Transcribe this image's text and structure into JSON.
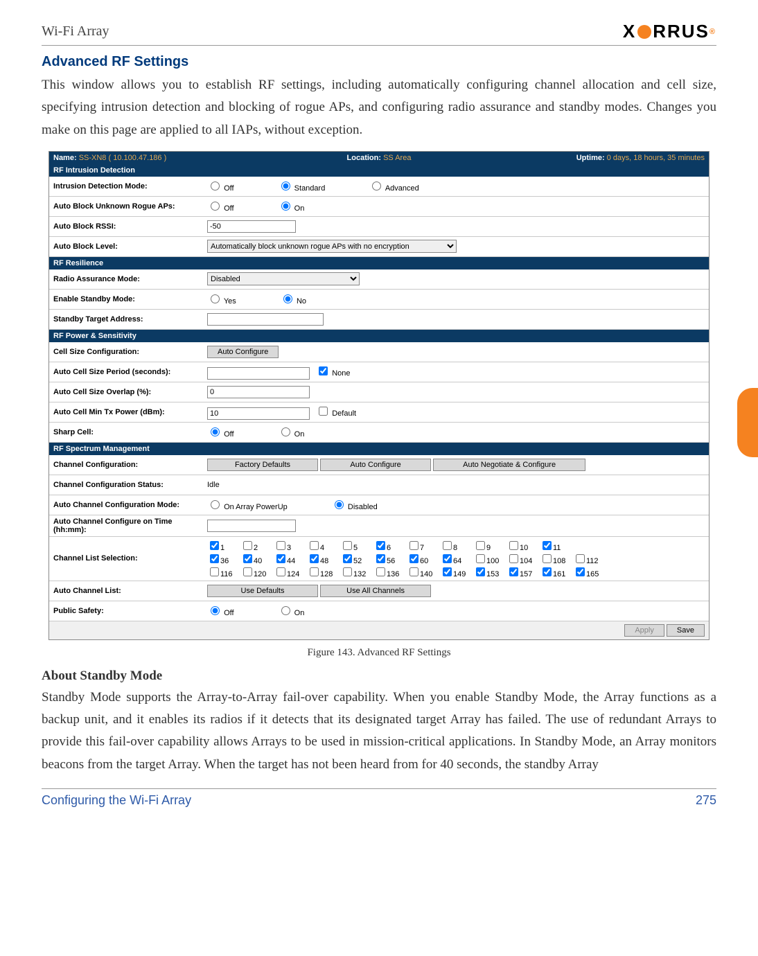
{
  "header": {
    "left": "Wi-Fi Array",
    "logo_text": "XIRRUS"
  },
  "section_title": "Advanced RF Settings",
  "intro": "This window allows you to establish RF settings, including automatically configuring channel allocation and cell size, specifying intrusion detection and blocking of rogue APs, and configuring radio assurance and standby modes. Changes you make on this page are applied to all IAPs, without exception.",
  "fig_caption": "Figure 143. Advanced RF Settings",
  "subhead": "About Standby Mode",
  "standby_text": "Standby Mode supports the Array-to-Array fail-over capability. When you enable Standby Mode, the Array functions as a backup unit, and it enables its radios if it detects that its designated target Array has failed. The use of redundant Arrays to provide this fail-over capability allows Arrays to be used in mission-critical applications. In Standby Mode, an Array monitors beacons from the target Array. When the target has not been heard from for 40 seconds, the standby Array",
  "footer": {
    "left": "Configuring the Wi-Fi Array",
    "page": "275"
  },
  "ui": {
    "top": {
      "name_lbl": "Name:",
      "name_val": "SS-XN8    ( 10.100.47.186 )",
      "loc_lbl": "Location:",
      "loc_val": "SS Area",
      "up_lbl": "Uptime:",
      "up_val": "0 days, 18 hours, 35 minutes"
    },
    "sect_intrusion": "RF Intrusion Detection",
    "idm_lbl": "Intrusion Detection Mode:",
    "idm_off": "Off",
    "idm_std": "Standard",
    "idm_adv": "Advanced",
    "abur_lbl": "Auto Block Unknown Rogue APs:",
    "abur_off": "Off",
    "abur_on": "On",
    "abrssi_lbl": "Auto Block RSSI:",
    "abrssi_val": "-50",
    "ablvl_lbl": "Auto Block Level:",
    "ablvl_val": "Automatically block unknown rogue APs with no encryption",
    "sect_res": "RF Resilience",
    "ram_lbl": "Radio Assurance Mode:",
    "ram_val": "Disabled",
    "esm_lbl": "Enable Standby Mode:",
    "esm_yes": "Yes",
    "esm_no": "No",
    "sta_lbl": "Standby Target Address:",
    "sta_val": "",
    "sect_pow": "RF Power & Sensitivity",
    "csc_lbl": "Cell Size Configuration:",
    "csc_btn": "Auto Configure",
    "acsp_lbl": "Auto Cell Size Period (seconds):",
    "acsp_val": "",
    "acsp_none": "None",
    "acso_lbl": "Auto Cell Size Overlap (%):",
    "acso_val": "0",
    "acmtp_lbl": "Auto Cell Min Tx Power (dBm):",
    "acmtp_val": "10",
    "acmtp_def": "Default",
    "sharp_lbl": "Sharp Cell:",
    "sharp_off": "Off",
    "sharp_on": "On",
    "sect_spec": "RF Spectrum Management",
    "cc_lbl": "Channel Configuration:",
    "cc_fd": "Factory Defaults",
    "cc_ac": "Auto Configure",
    "cc_anc": "Auto Negotiate & Configure",
    "ccs_lbl": "Channel Configuration Status:",
    "ccs_val": "Idle",
    "accm_lbl": "Auto Channel Configuration Mode:",
    "accm_pu": "On Array PowerUp",
    "accm_dis": "Disabled",
    "acct_lbl": "Auto Channel Configure on Time (hh:mm):",
    "acct_val": "",
    "cls_lbl": "Channel List Selection:",
    "acl_lbl": "Auto Channel List:",
    "acl_ud": "Use Defaults",
    "acl_uac": "Use All Channels",
    "ps_lbl": "Public Safety:",
    "ps_off": "Off",
    "ps_on": "On",
    "apply": "Apply",
    "save": "Save",
    "channels": {
      "r1": [
        {
          "n": "1",
          "c": true
        },
        {
          "n": "2",
          "c": false
        },
        {
          "n": "3",
          "c": false
        },
        {
          "n": "4",
          "c": false
        },
        {
          "n": "5",
          "c": false
        },
        {
          "n": "6",
          "c": true
        },
        {
          "n": "7",
          "c": false
        },
        {
          "n": "8",
          "c": false
        },
        {
          "n": "9",
          "c": false
        },
        {
          "n": "10",
          "c": false
        },
        {
          "n": "11",
          "c": true
        }
      ],
      "r2": [
        {
          "n": "36",
          "c": true
        },
        {
          "n": "40",
          "c": true
        },
        {
          "n": "44",
          "c": true
        },
        {
          "n": "48",
          "c": true
        },
        {
          "n": "52",
          "c": true
        },
        {
          "n": "56",
          "c": true
        },
        {
          "n": "60",
          "c": true
        },
        {
          "n": "64",
          "c": true
        },
        {
          "n": "100",
          "c": false
        },
        {
          "n": "104",
          "c": false
        },
        {
          "n": "108",
          "c": false
        },
        {
          "n": "112",
          "c": false
        }
      ],
      "r3": [
        {
          "n": "116",
          "c": false
        },
        {
          "n": "120",
          "c": false
        },
        {
          "n": "124",
          "c": false
        },
        {
          "n": "128",
          "c": false
        },
        {
          "n": "132",
          "c": false
        },
        {
          "n": "136",
          "c": false
        },
        {
          "n": "140",
          "c": false
        },
        {
          "n": "149",
          "c": true
        },
        {
          "n": "153",
          "c": true
        },
        {
          "n": "157",
          "c": true
        },
        {
          "n": "161",
          "c": true
        },
        {
          "n": "165",
          "c": true
        }
      ]
    }
  }
}
